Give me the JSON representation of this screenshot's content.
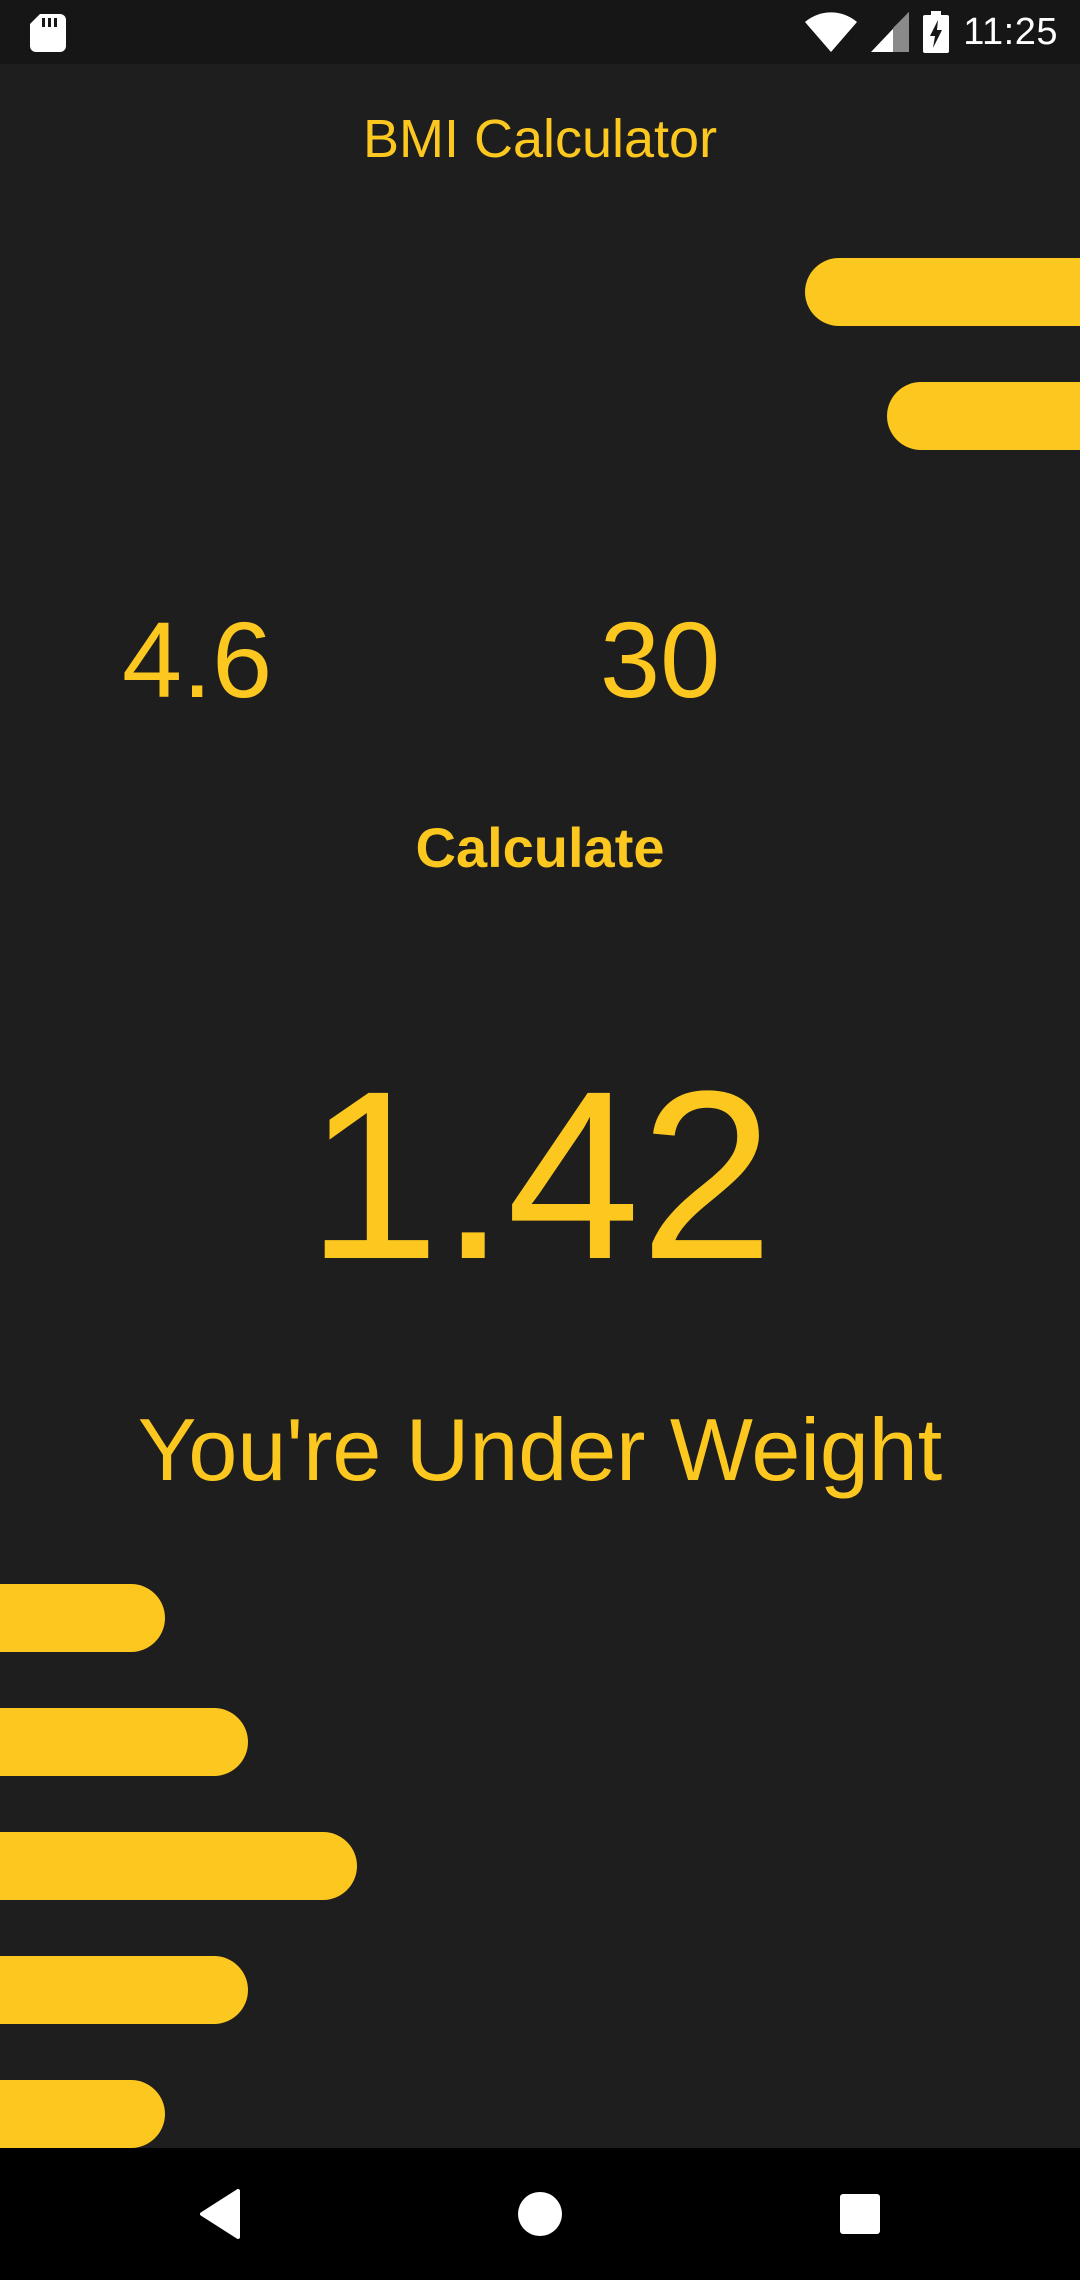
{
  "status_bar": {
    "time": "11:25",
    "icons": [
      "sd-card-icon",
      "wifi-icon",
      "cell-signal-icon",
      "battery-charging-icon"
    ]
  },
  "app": {
    "title": "BMI Calculator",
    "accent_color": "#fcc81f",
    "background_color": "#1e1e1e"
  },
  "inputs": {
    "weight_value": "4.6",
    "height_value": "30"
  },
  "calculate_label": "Calculate",
  "result": {
    "bmi": "1.42",
    "status": "You're Under Weight"
  },
  "nav": {
    "icons": [
      "back-icon",
      "home-icon",
      "recents-icon"
    ]
  }
}
